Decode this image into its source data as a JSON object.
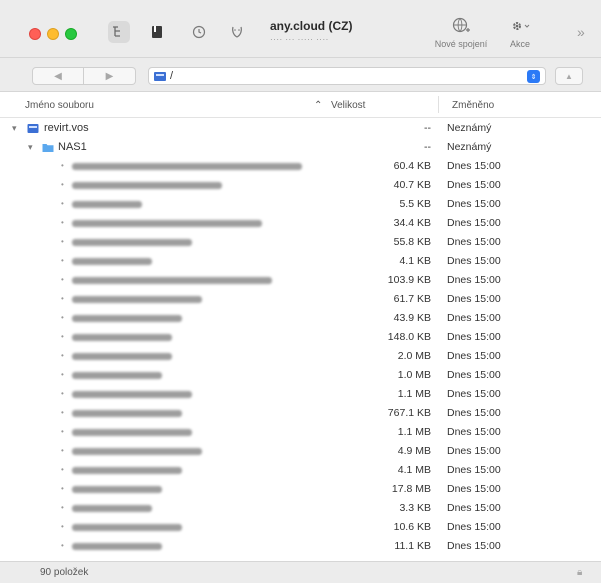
{
  "toolbar": {
    "connection_title": "any.cloud (CZ)",
    "connection_subtitle": "···· ··· ····· ····",
    "new_connection_label": "Nové spojení",
    "actions_label": "Akce"
  },
  "pathbar": {
    "path": "/"
  },
  "columns": {
    "name": "Jméno souboru",
    "size": "Velikost",
    "modified": "Změněno"
  },
  "rows": [
    {
      "name": "revirt.vos",
      "size": "--",
      "modified": "Neznámý"
    },
    {
      "name": "NAS1",
      "size": "--",
      "modified": "Neznámý"
    },
    {
      "size": "60.4 KB",
      "modified": "Dnes 15:00"
    },
    {
      "size": "40.7 KB",
      "modified": "Dnes 15:00"
    },
    {
      "size": "5.5 KB",
      "modified": "Dnes 15:00"
    },
    {
      "size": "34.4 KB",
      "modified": "Dnes 15:00"
    },
    {
      "size": "55.8 KB",
      "modified": "Dnes 15:00"
    },
    {
      "size": "4.1 KB",
      "modified": "Dnes 15:00"
    },
    {
      "size": "103.9 KB",
      "modified": "Dnes 15:00"
    },
    {
      "size": "61.7 KB",
      "modified": "Dnes 15:00"
    },
    {
      "size": "43.9 KB",
      "modified": "Dnes 15:00"
    },
    {
      "size": "148.0 KB",
      "modified": "Dnes 15:00"
    },
    {
      "size": "2.0 MB",
      "modified": "Dnes 15:00"
    },
    {
      "size": "1.0 MB",
      "modified": "Dnes 15:00"
    },
    {
      "size": "1.1 MB",
      "modified": "Dnes 15:00"
    },
    {
      "size": "767.1 KB",
      "modified": "Dnes 15:00"
    },
    {
      "size": "1.1 MB",
      "modified": "Dnes 15:00"
    },
    {
      "size": "4.9 MB",
      "modified": "Dnes 15:00"
    },
    {
      "size": "4.1 MB",
      "modified": "Dnes 15:00"
    },
    {
      "size": "17.8 MB",
      "modified": "Dnes 15:00"
    },
    {
      "size": "3.3 KB",
      "modified": "Dnes 15:00"
    },
    {
      "size": "10.6 KB",
      "modified": "Dnes 15:00"
    },
    {
      "size": "11.1 KB",
      "modified": "Dnes 15:00"
    }
  ],
  "status": {
    "count": "90 položek"
  }
}
